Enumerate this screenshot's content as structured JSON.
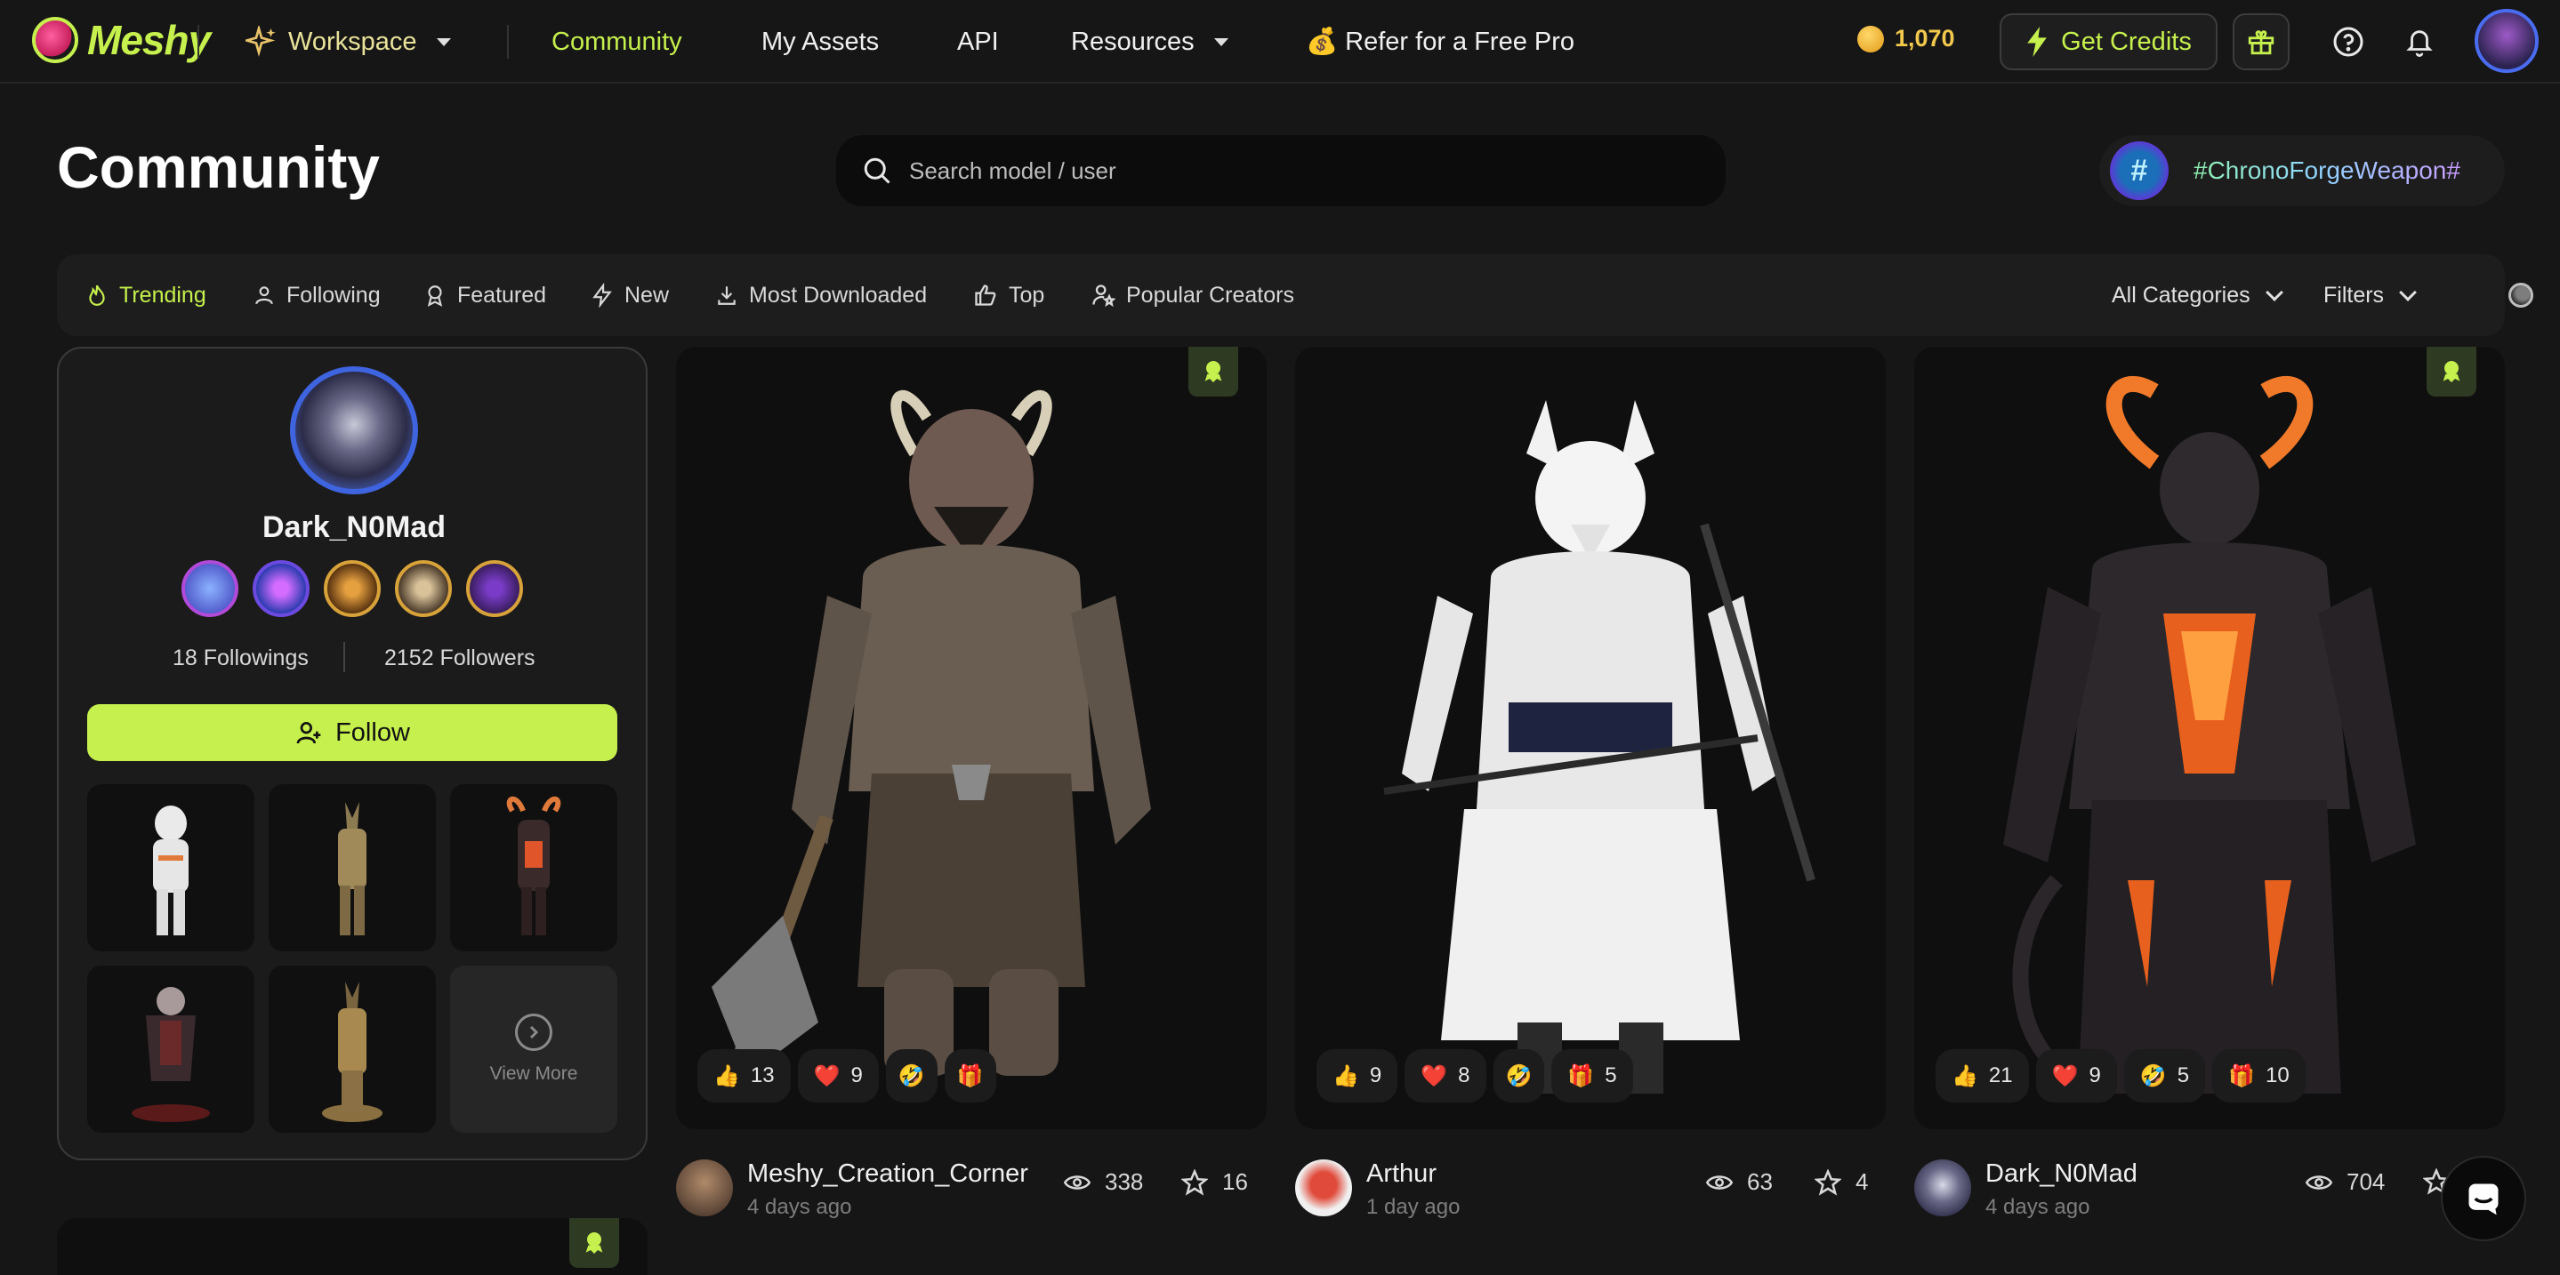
{
  "nav": {
    "logo_text": "Meshy",
    "workspace_label": "Workspace",
    "community_label": "Community",
    "my_assets_label": "My Assets",
    "api_label": "API",
    "resources_label": "Resources",
    "refer_label": "💰 Refer for a Free Pro",
    "credits_value": "1,070",
    "get_credits_label": "Get Credits"
  },
  "header": {
    "title": "Community",
    "search_placeholder": "Search model / user",
    "hashtag": "#ChronoForgeWeapon#"
  },
  "filters": {
    "tabs": [
      {
        "label": "Trending",
        "icon": "flame-icon",
        "active": true
      },
      {
        "label": "Following",
        "icon": "person-icon"
      },
      {
        "label": "Featured",
        "icon": "award-icon"
      },
      {
        "label": "New",
        "icon": "bolt-icon"
      },
      {
        "label": "Most Downloaded",
        "icon": "download-icon"
      },
      {
        "label": "Top",
        "icon": "thumbs-up-icon"
      },
      {
        "label": "Popular Creators",
        "icon": "creator-star-icon"
      }
    ],
    "categories_label": "All Categories",
    "filters_label": "Filters"
  },
  "profile": {
    "name": "Dark_N0Mad",
    "followings": "18 Followings",
    "followers": "2152 Followers",
    "follow_label": "Follow",
    "view_more_label": "View More"
  },
  "cards": [
    {
      "author": "Meshy_Creation_Corner",
      "time": "4 days ago",
      "views": "338",
      "stars": "16",
      "reactions": {
        "thumbs": "13",
        "heart": "9",
        "laugh": "",
        "gift": ""
      }
    },
    {
      "author": "Arthur",
      "time": "1 day ago",
      "views": "63",
      "stars": "4",
      "reactions": {
        "thumbs": "9",
        "heart": "8",
        "laugh": "",
        "gift": "5"
      }
    },
    {
      "author": "Dark_N0Mad",
      "time": "4 days ago",
      "views": "704",
      "stars": "",
      "reactions": {
        "thumbs": "21",
        "heart": "9",
        "laugh": "5",
        "gift": "10"
      }
    }
  ],
  "colors": {
    "accent": "#c6f04d",
    "background": "#161616",
    "card": "#0f0f0f"
  }
}
